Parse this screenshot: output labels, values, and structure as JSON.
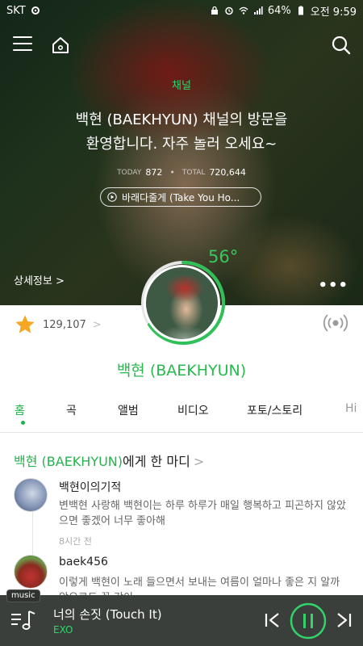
{
  "status_bar": {
    "carrier": "SKT",
    "battery": "64%",
    "time": "오전 9:59"
  },
  "hero": {
    "channel_label": "채널",
    "headline_line1": "백현 (BAEKHYUN) 채널의 방문을",
    "headline_line2": "환영합니다. 자주 놀러 오세요~",
    "today_label": "TODAY",
    "today_value": "872",
    "total_label": "TOTAL",
    "total_value": "720,644",
    "now_playing": "바래다줄게 (Take You Ho...",
    "detail_link": "상세정보 >",
    "more_label": "•••"
  },
  "profile": {
    "temperature": "56°",
    "likes": "129,107",
    "likes_chevron": ">",
    "artist_name": "백현 (BAEKHYUN)"
  },
  "tabs": [
    {
      "label": "홈",
      "active": true
    },
    {
      "label": "곡"
    },
    {
      "label": "앨범"
    },
    {
      "label": "비디오"
    },
    {
      "label": "포토/스토리"
    },
    {
      "label": "Hi"
    }
  ],
  "comments": {
    "title_green": "백현 (BAEKHYUN)",
    "title_rest": "에게 한 마디",
    "title_chevron": ">",
    "items": [
      {
        "user": "백현이의기적",
        "text": "변백현 사랑해 백현이는 하루 하루가 매일 행복하고 피곤하지 않았으면 좋겠어 너무 좋아해",
        "time": "8시간 전"
      },
      {
        "user": "baek456",
        "text": "이렇게 백현이 노래 들으면서 보내는 여름이 얼마나 좋은 지 알까 앞으로도 꼭 같이",
        "time": ""
      }
    ]
  },
  "player": {
    "tag": "music",
    "title": "너의 손짓 (Touch It)",
    "artist": "EXO"
  },
  "colors": {
    "accent": "#27b34d",
    "player_bg": "#3a3f3b"
  }
}
